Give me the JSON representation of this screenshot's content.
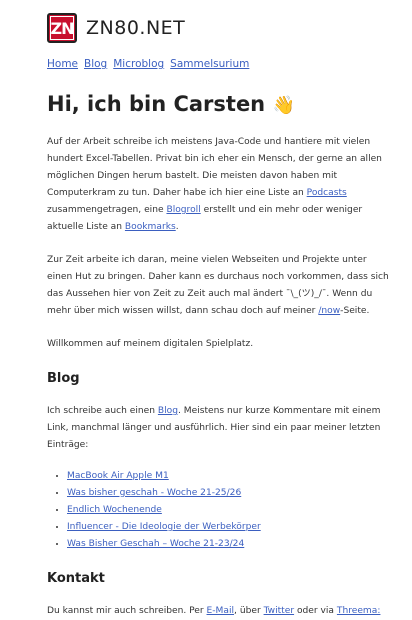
{
  "header": {
    "logo_text": "ZN",
    "site_name": "ZN80.NET"
  },
  "nav": {
    "items": [
      "Home",
      "Blog",
      "Microblog",
      "Sammelsurium"
    ]
  },
  "hero": {
    "title": "Hi, ich bin Carsten",
    "emoji": "👋"
  },
  "intro": {
    "p1_a": "Auf der Arbeit schreibe ich meistens Java-Code und hantiere mit vielen hundert Excel-Tabellen. Privat bin ich eher ein Mensch, der gerne an allen möglichen Dingen herum bastelt. Die meisten davon haben mit Computerkram zu tun. Daher habe ich hier eine Liste an ",
    "p1_link1": "Podcasts",
    "p1_b": " zusammengetragen, eine ",
    "p1_link2": "Blogroll",
    "p1_c": " erstellt und ein mehr oder weniger aktuelle Liste an ",
    "p1_link3": "Bookmarks",
    "p1_d": ".",
    "p2_a": "Zur Zeit arbeite ich daran, meine vielen Webseiten und Projekte unter einen Hut zu bringen. Daher kann es durchaus noch vorkommen, dass sich das Aussehen hier von Zeit zu Zeit auch mal ändert ¯\\_(ツ)_/¯. Wenn du mehr über mich wissen willst, dann schau doch auf meiner ",
    "p2_link": "/now",
    "p2_b": "-Seite.",
    "p3": "Willkommen auf meinem digitalen Spielplatz."
  },
  "blog": {
    "heading": "Blog",
    "p_a": "Ich schreibe auch einen ",
    "p_link": "Blog",
    "p_b": ". Meistens nur kurze Kommentare mit einem Link, manchmal länger und ausführlich. Hier sind ein paar meiner letzten Einträge:",
    "entries": [
      "MacBook Air Apple M1",
      "Was bisher geschah - Woche 21-25/26",
      "Endlich Wochenende",
      "Influencer - Die Ideologie der Werbekörper",
      "Was Bisher Geschah – Woche 21-23/24"
    ]
  },
  "contact": {
    "heading": "Kontakt",
    "p_a": "Du kannst mir auch schreiben. Per ",
    "link1": "E-Mail",
    "p_b": ", über ",
    "link2": "Twitter",
    "p_c": " oder via ",
    "link3": "Threema:"
  }
}
